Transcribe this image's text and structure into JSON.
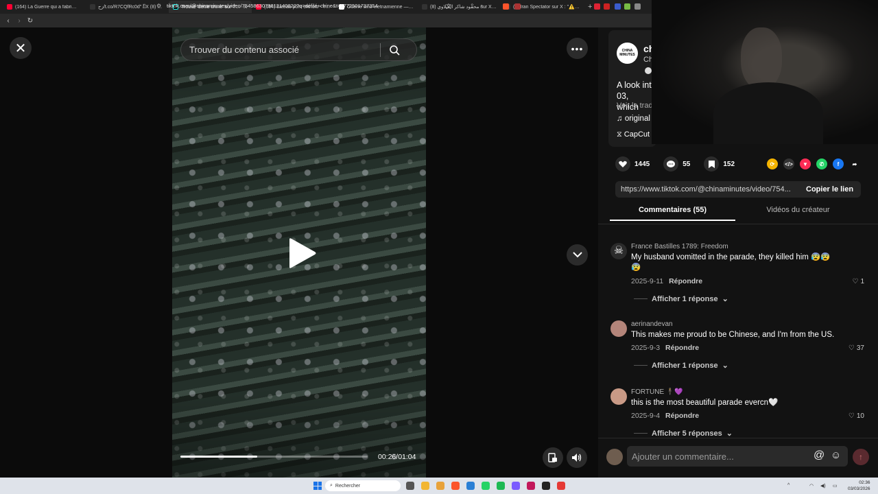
{
  "browser": {
    "tabs": [
      {
        "title": "(164) La Guerre qui a fabriqué la Rus...",
        "fav_color": "#ff0033",
        "active": false
      },
      {
        "title": "زح/t.co/R7CQfRc0d\" / X الحولي (8)",
        "fav_color": "#222222",
        "active": false
      },
      {
        "title": "Trouvé 'défilé chine' sur TikTok |",
        "fav_color": "#111111",
        "active": true
      },
      {
        "title": "(164) bateau pont chinois - YouTube",
        "fav_color": "#ff0033",
        "active": false
      },
      {
        "title": "Guerre sino-vietnamienne — Wikipé...",
        "fav_color": "#ffffff",
        "active": false
      },
      {
        "title": "محمود شاكر القبلاوي (8) sur X : \"3 ...",
        "fav_color": "#222222",
        "active": false
      },
      {
        "title": "(8) Iran Spectator sur X : \"⚠️ Breaki...",
        "fav_color": "#222222",
        "active": false
      }
    ],
    "new_tab": "+",
    "url": "tiktok.com/@chinaminutes/video/7545863079612140822?q=défilé+chine&t=1772501737354"
  },
  "video": {
    "search_placeholder": "Trouver du contenu associé",
    "current_time": "00:26",
    "duration": "01:04",
    "time_text": "00:26/01:04",
    "progress_fraction": 0.41
  },
  "creator": {
    "avatar_text": "CHINA MINUTES",
    "name": "ch",
    "sub": "Ch",
    "description": "A look int 03, which",
    "translate": "Voir la trad",
    "sound": "original",
    "capcut": "CapCut"
  },
  "actions": {
    "likes": "1445",
    "comments": "55",
    "saves": "152"
  },
  "share_icons": [
    {
      "name": "repost-icon",
      "color": "#f5b400",
      "glyph": "⟳"
    },
    {
      "name": "embed-icon",
      "color": "#333333",
      "glyph": "</>"
    },
    {
      "name": "send-friend-icon",
      "color": "#fe2c55",
      "glyph": "▼"
    },
    {
      "name": "whatsapp-icon",
      "color": "#25d366",
      "glyph": "✆"
    },
    {
      "name": "facebook-icon",
      "color": "#1877f2",
      "glyph": "f"
    },
    {
      "name": "share-arrow-icon",
      "color": "transparent",
      "glyph": "➦"
    }
  ],
  "link": {
    "url": "https://www.tiktok.com/@chinaminutes/video/754...",
    "copy_label": "Copier le lien"
  },
  "panel_tabs": {
    "comments": "Commentaires (55)",
    "creator_videos": "Vidéos du créateur"
  },
  "comments": [
    {
      "user": "France Bastilles 1789: Freedom",
      "text": "My husband vomitted in the parade, they killed him 😰😰😰",
      "date": "2025-9-11",
      "reply": "Répondre",
      "likes": "1",
      "more": "Afficher 1 réponse",
      "avatar_color": "#2b2b2b"
    },
    {
      "user": "aerinandevan",
      "text": "This makes me proud to be Chinese, and I'm from the US.",
      "date": "2025-9-3",
      "reply": "Répondre",
      "likes": "37",
      "more": "Afficher 1 réponse",
      "avatar_color": "#b4857a"
    },
    {
      "user": "FORTUNE 🕴️💜",
      "text": "this is the most beautiful parade evercn🤍",
      "date": "2025-9-4",
      "reply": "Répondre",
      "likes": "10",
      "more": "Afficher 5 réponses",
      "avatar_color": "#c99a86"
    }
  ],
  "compose": {
    "placeholder": "Ajouter un commentaire..."
  },
  "taskbar": {
    "search_label": "Rechercher",
    "time": "02:36",
    "date": "03/03/2026"
  }
}
